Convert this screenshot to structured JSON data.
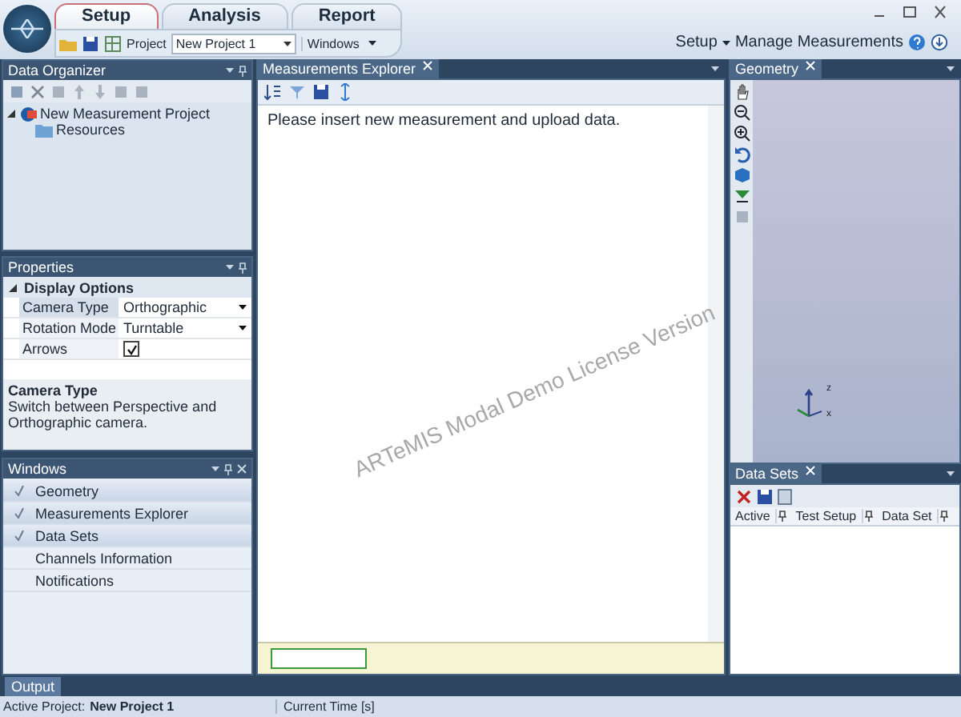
{
  "ribbon": {
    "tabs": [
      {
        "label": "Setup",
        "selected": true
      },
      {
        "label": "Analysis",
        "selected": false
      },
      {
        "label": "Report",
        "selected": false
      }
    ],
    "project_label": "Project",
    "project_value": "New Project 1",
    "windows_menu": "Windows",
    "setup_menu": "Setup",
    "manage_link": "Manage Measurements"
  },
  "data_organizer": {
    "title": "Data Organizer",
    "tree": [
      {
        "label": "New Measurement Project",
        "expanded": true,
        "children": [
          {
            "label": "Resources"
          }
        ]
      }
    ]
  },
  "properties": {
    "title": "Properties",
    "category": {
      "label": "Display Options",
      "expanded": true
    },
    "rows": [
      {
        "name": "Camera Type",
        "kind": "dropdown",
        "value": "Orthographic",
        "selected": true
      },
      {
        "name": "Rotation Mode",
        "kind": "dropdown",
        "value": "Turntable",
        "selected": false
      },
      {
        "name": "Arrows",
        "kind": "checkbox",
        "checked": true,
        "selected": false
      }
    ],
    "description": {
      "title": "Camera Type",
      "text": "Switch between Perspective and Orthographic camera."
    }
  },
  "windows_panel": {
    "title": "Windows",
    "items": [
      {
        "label": "Geometry",
        "checked": true
      },
      {
        "label": "Measurements Explorer",
        "checked": true
      },
      {
        "label": "Data Sets",
        "checked": true
      },
      {
        "label": "Channels Information",
        "checked": false
      },
      {
        "label": "Notifications",
        "checked": false
      }
    ]
  },
  "measurements_explorer": {
    "tab": "Measurements Explorer",
    "message": "Please insert new measurement and upload data.",
    "watermark": "ARTeMIS Modal Demo License Version"
  },
  "geometry": {
    "tab": "Geometry",
    "axis_labels": [
      "z",
      "x"
    ]
  },
  "data_sets": {
    "tab": "Data Sets",
    "columns": [
      "Active",
      "Test Setup",
      "Data Set"
    ]
  },
  "output_tab": "Output",
  "status_bar": {
    "active_label": "Active Project:",
    "active_project": "New Project 1",
    "current_time": "Current Time [s]"
  }
}
